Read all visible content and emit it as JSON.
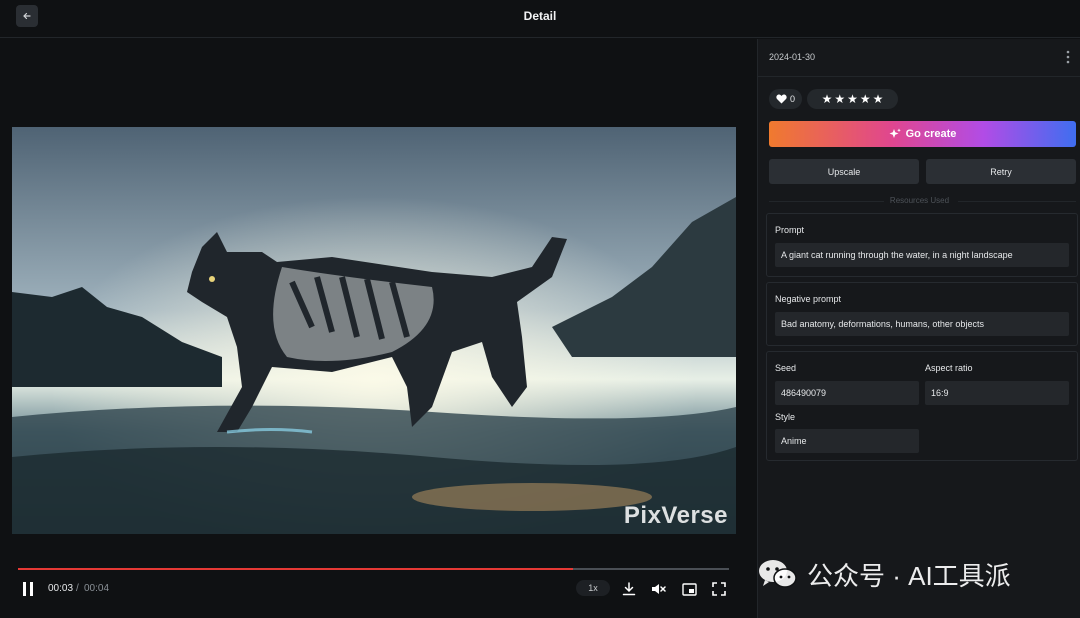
{
  "header": {
    "title": "Detail"
  },
  "video": {
    "watermark": "PixVerse",
    "current_time": "00:03",
    "separator": "/",
    "total_time": "00:04",
    "progress": 0.78,
    "speed": "1x"
  },
  "sidebar": {
    "date": "2024-01-30",
    "likes": "0",
    "rating_stars": 5,
    "go_create_label": "Go create",
    "upscale_label": "Upscale",
    "retry_label": "Retry",
    "resources_label": "Resources Used",
    "prompt": {
      "label": "Prompt",
      "value": "A giant cat running through the water, in a night landscape"
    },
    "negative_prompt": {
      "label": "Negative prompt",
      "value": "Bad anatomy, deformations, humans, other objects"
    },
    "seed": {
      "label": "Seed",
      "value": "486490079"
    },
    "aspect_ratio": {
      "label": "Aspect ratio",
      "value": "16:9"
    },
    "style": {
      "label": "Style",
      "value": "Anime"
    }
  },
  "overlay_watermark": {
    "text": "公众号 · AI工具派"
  },
  "colors": {
    "progress": "#e53935",
    "accent_start": "#f07a2e",
    "accent_end": "#3f6ef0"
  }
}
